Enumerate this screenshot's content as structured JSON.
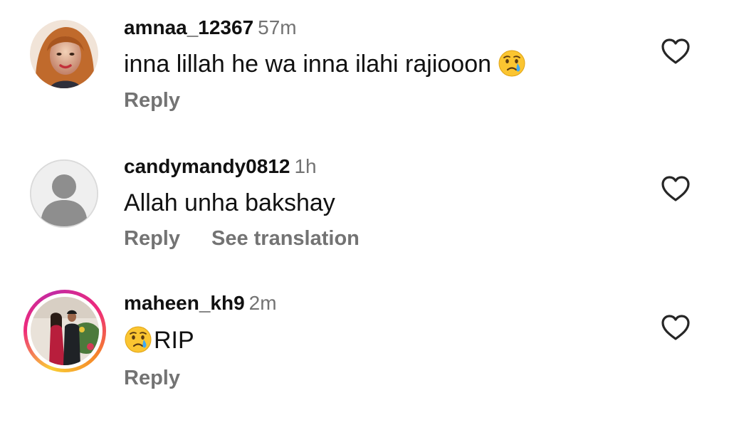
{
  "comments": [
    {
      "username": "amnaa_12367",
      "timestamp": "57m",
      "text": "inna lillah he wa inna ilahi rajiooon",
      "emoji": "crying-face",
      "actions": {
        "reply": "Reply"
      }
    },
    {
      "username": "candymandy0812",
      "timestamp": "1h",
      "text": "Allah unha bakshay",
      "actions": {
        "reply": "Reply",
        "translate": "See translation"
      }
    },
    {
      "username": "maheen_kh9",
      "timestamp": "2m",
      "text": "RIP",
      "emoji": "crying-face",
      "actions": {
        "reply": "Reply"
      }
    }
  ],
  "colors": {
    "secondary_text": "#737373",
    "primary_text": "#111111",
    "story_ring_start": "#f9ce34",
    "story_ring_end": "#c32aa3"
  },
  "icons": {
    "like": "heart-outline-icon",
    "default_avatar": "default-user-avatar",
    "emoji": "crying-face-emoji"
  }
}
